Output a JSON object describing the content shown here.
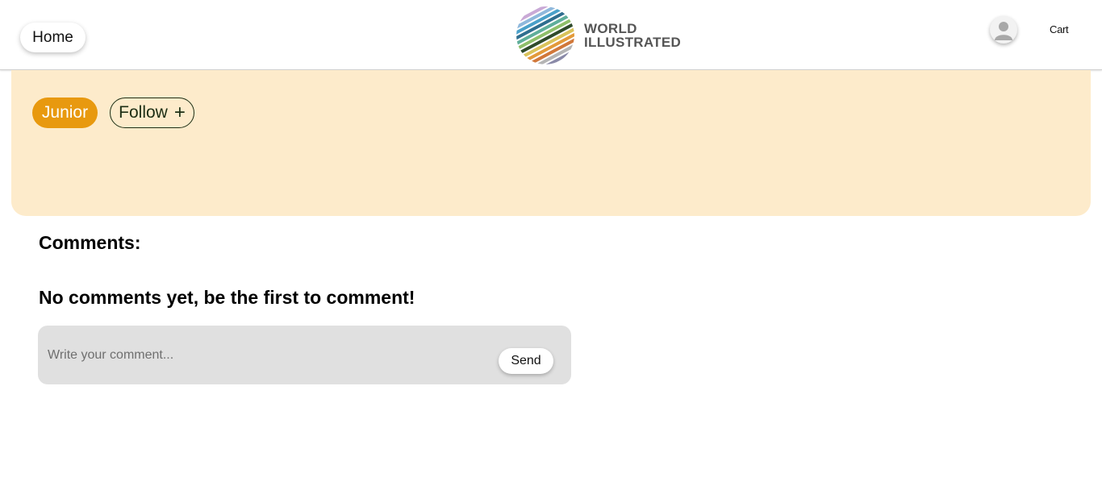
{
  "header": {
    "home_label": "Home",
    "logo": {
      "line1": "WORLD",
      "line2": "ILLUSTRATED"
    },
    "avatar_icon": "user-avatar-icon",
    "cart_label": "Cart"
  },
  "profile": {
    "badge_label": "Junior",
    "badge_color": "#e8990f",
    "follow_label": "Follow",
    "follow_icon": "+",
    "banner_color": "#fdebcb"
  },
  "comments": {
    "title": "Comments:",
    "empty_message": "No comments yet, be the first to comment!",
    "input_placeholder": "Write your comment...",
    "input_value": "",
    "send_label": "Send"
  }
}
